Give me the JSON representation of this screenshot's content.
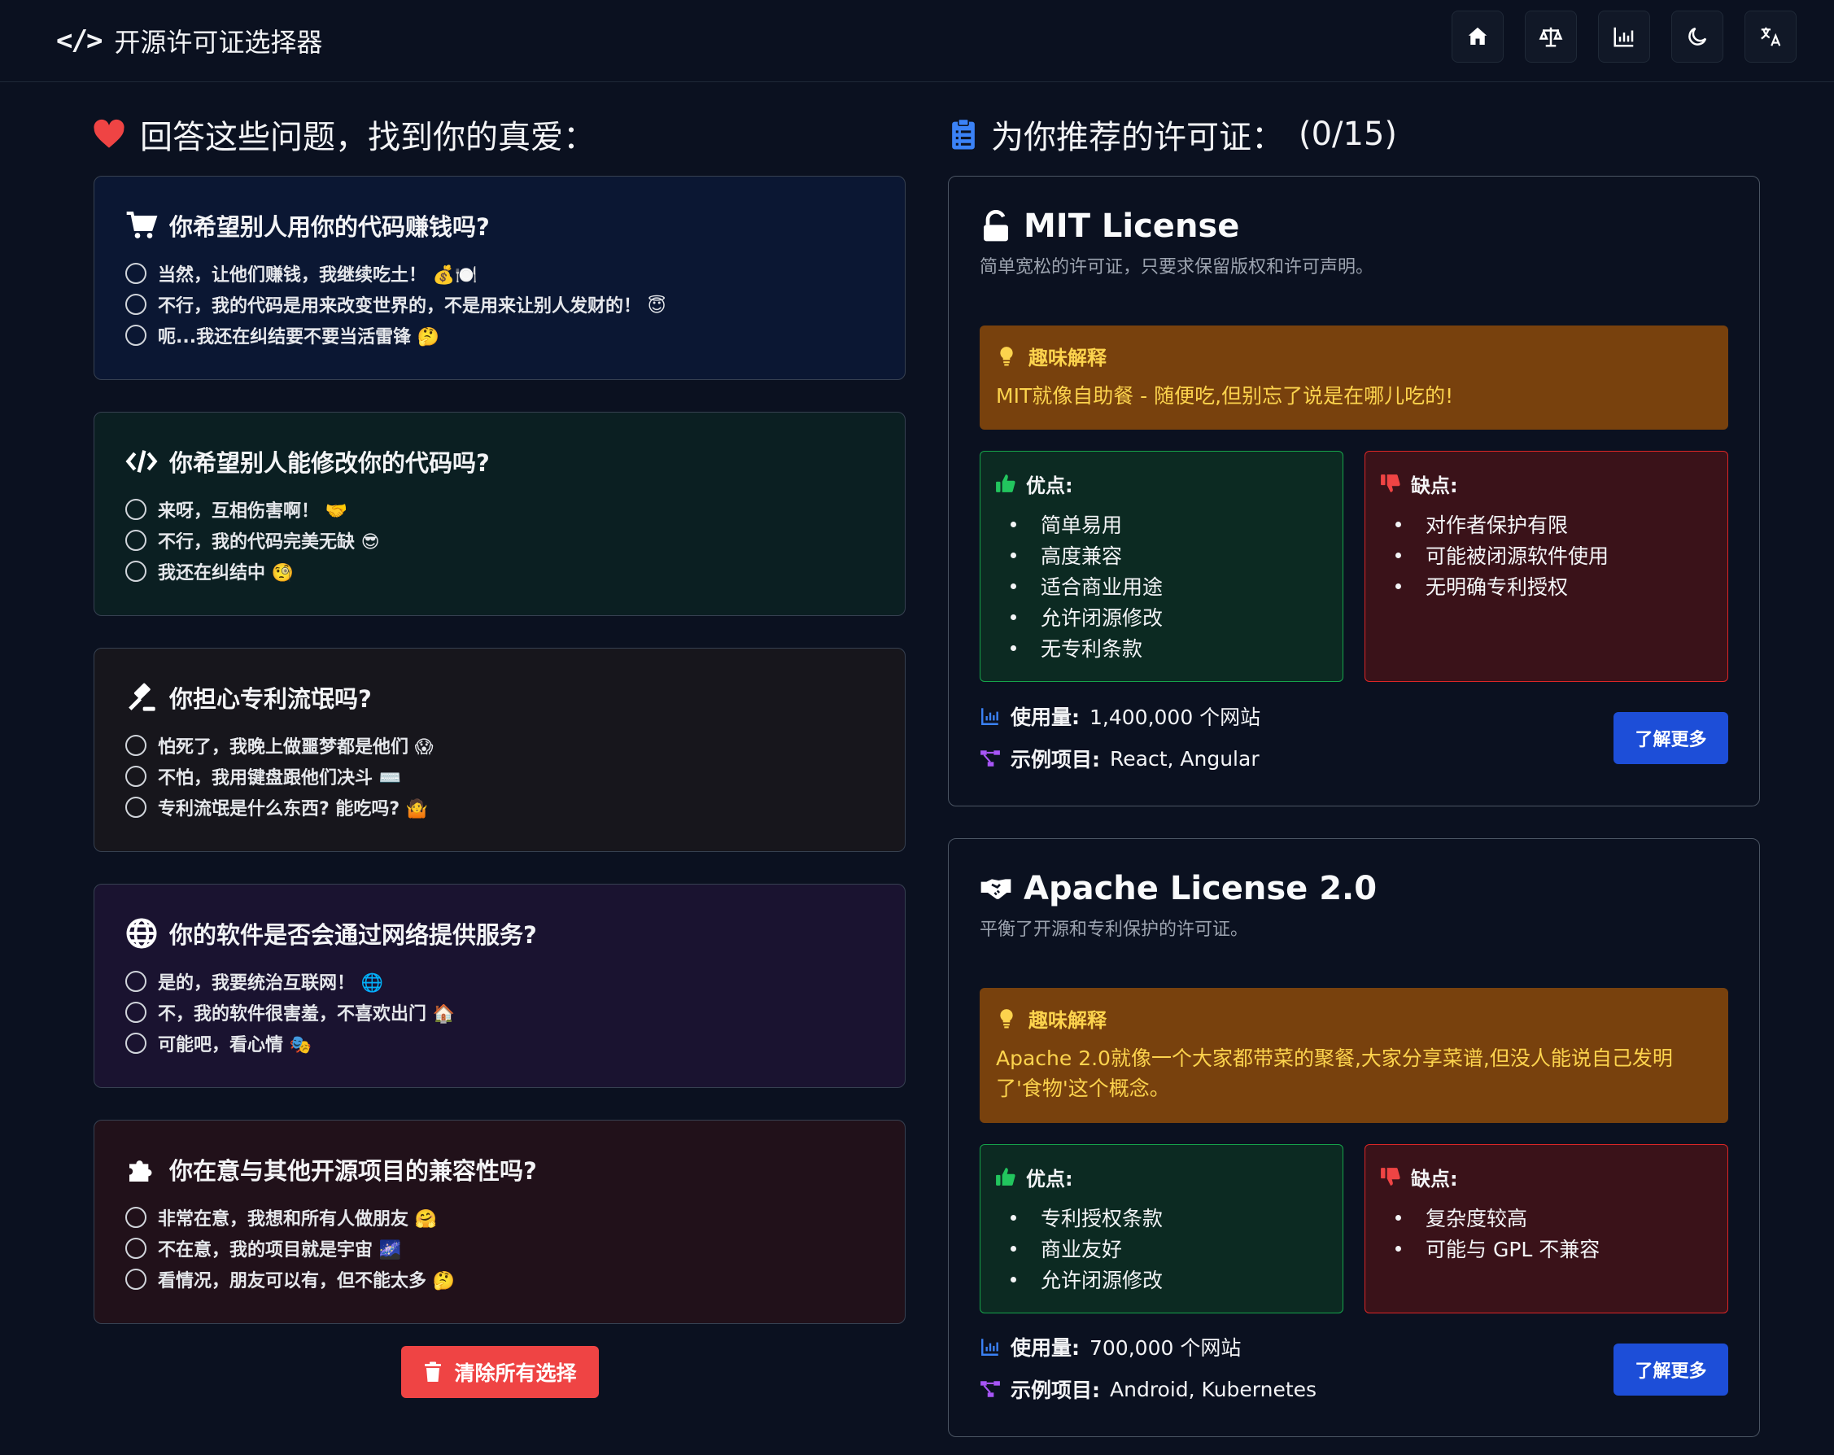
{
  "app": {
    "title": "开源许可证选择器"
  },
  "nav": [
    {
      "icon": "home-icon"
    },
    {
      "icon": "scale-icon"
    },
    {
      "icon": "chart-icon"
    },
    {
      "icon": "moon-icon"
    },
    {
      "icon": "translate-icon"
    }
  ],
  "left": {
    "title": "回答这些问题，找到你的真爱："
  },
  "questions": [
    {
      "title": "你希望别人用你的代码赚钱吗?",
      "icon": "cart-icon",
      "bg": "#0b1733",
      "options": [
        "当然，让他们赚钱，我继续吃土！ 💰🍽️",
        "不行，我的代码是用来改变世界的，不是用来让别人发财的！ 😇",
        "呃...我还在纠结要不要当活雷锋 🤔"
      ]
    },
    {
      "title": "你希望别人能修改你的代码吗?",
      "icon": "code-icon",
      "bg": "#0b1f22",
      "options": [
        "来呀，互相伤害啊！ 🤝",
        "不行，我的代码完美无缺 😎",
        "我还在纠结中 🧐"
      ]
    },
    {
      "title": "你担心专利流氓吗?",
      "icon": "gavel-icon",
      "bg": "#17161c",
      "options": [
        "怕死了，我晚上做噩梦都是他们 😱",
        "不怕，我用键盘跟他们决斗 ⌨️",
        "专利流氓是什么东西? 能吃吗? 🤷"
      ]
    },
    {
      "title": "你的软件是否会通过网络提供服务?",
      "icon": "globe-icon",
      "bg": "#1a1330",
      "options": [
        "是的，我要统治互联网！ 🌐",
        "不，我的软件很害羞，不喜欢出门 🏠",
        "可能吧，看心情 🎭"
      ]
    },
    {
      "title": "你在意与其他开源项目的兼容性吗?",
      "icon": "puzzle-icon",
      "bg": "#21111a",
      "options": [
        "非常在意，我想和所有人做朋友 🤗",
        "不在意，我的项目就是宇宙 🌌",
        "看情况，朋友可以有，但不能太多 🤔"
      ]
    }
  ],
  "clear_label": "清除所有选择",
  "right": {
    "title": "为你推荐的许可证：",
    "count": "(0/15)"
  },
  "licenses": [
    {
      "name": "MIT License",
      "icon": "unlock-icon",
      "desc": "简单宽松的许可证，只要求保留版权和许可声明。",
      "fun_title": "趣味解释",
      "fun_text": "MIT就像自助餐 - 随便吃,但别忘了说是在哪儿吃的!",
      "pros_title": "优点:",
      "pros": [
        "简单易用",
        "高度兼容",
        "适合商业用途",
        "允许闭源修改",
        "无专利条款"
      ],
      "cons_title": "缺点:",
      "cons": [
        "对作者保护有限",
        "可能被闭源软件使用",
        "无明确专利授权"
      ],
      "usage_label": "使用量:",
      "usage": "1,400,000 个网站",
      "examples_label": "示例项目:",
      "examples": "React, Angular",
      "more": "了解更多"
    },
    {
      "name": "Apache License 2.0",
      "icon": "handshake-icon",
      "desc": "平衡了开源和专利保护的许可证。",
      "fun_title": "趣味解释",
      "fun_text": "Apache 2.0就像一个大家都带菜的聚餐,大家分享菜谱,但没人能说自己发明了'食物'这个概念。",
      "pros_title": "优点:",
      "pros": [
        "专利授权条款",
        "商业友好",
        "允许闭源修改"
      ],
      "cons_title": "缺点:",
      "cons": [
        "复杂度较高",
        "可能与 GPL 不兼容"
      ],
      "usage_label": "使用量:",
      "usage": "700,000 个网站",
      "examples_label": "示例项目:",
      "examples": "Android, Kubernetes",
      "more": "了解更多"
    }
  ],
  "colors": {
    "pros_border": "#16a34a",
    "cons_border": "#dc2626",
    "accent": "#1d4ed8",
    "danger": "#ef4444",
    "heart": "#ef4444"
  }
}
